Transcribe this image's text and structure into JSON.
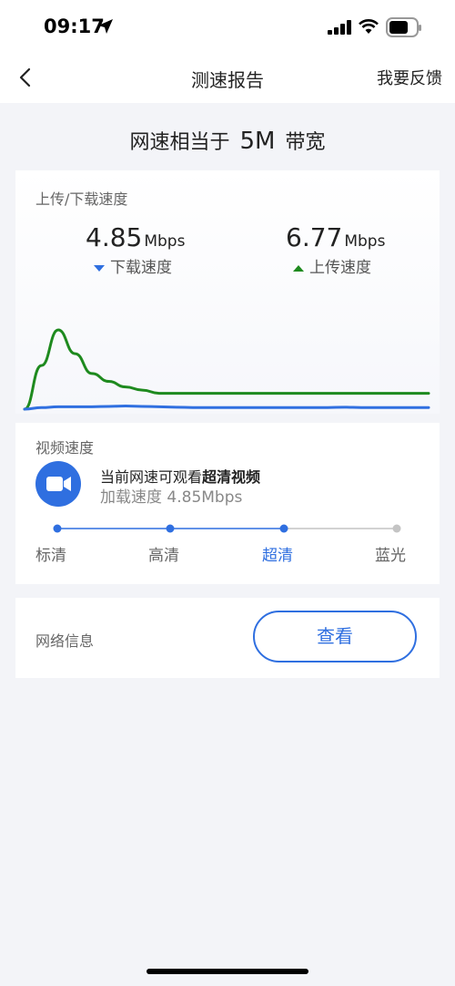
{
  "status": {
    "time": "09:17"
  },
  "nav": {
    "title": "测速报告",
    "feedback": "我要反馈"
  },
  "headline": {
    "prefix": "网速相当于",
    "value": "5M",
    "suffix": "带宽"
  },
  "speed_card": {
    "label": "上传/下载速度",
    "download": {
      "value": "4.85",
      "unit": "Mbps",
      "label": "下载速度"
    },
    "upload": {
      "value": "6.77",
      "unit": "Mbps",
      "label": "上传速度"
    }
  },
  "chart_data": {
    "type": "line",
    "series": [
      {
        "color": "#1e8a1e",
        "values": [
          0.0,
          0.55,
          1.0,
          0.7,
          0.45,
          0.35,
          0.28,
          0.24,
          0.2,
          0.2,
          0.2,
          0.2,
          0.2,
          0.2,
          0.2,
          0.2,
          0.2,
          0.2,
          0.2,
          0.2,
          0.2,
          0.2,
          0.2,
          0.2,
          0.2
        ]
      },
      {
        "color": "#2f6fe0",
        "values": [
          0.0,
          0.02,
          0.03,
          0.03,
          0.03,
          0.035,
          0.04,
          0.035,
          0.03,
          0.025,
          0.02,
          0.02,
          0.02,
          0.02,
          0.02,
          0.02,
          0.02,
          0.02,
          0.02,
          0.025,
          0.02,
          0.02,
          0.02,
          0.02,
          0.02
        ]
      }
    ]
  },
  "video_card": {
    "label": "视频速度",
    "line1_prefix": "当前网速可观看",
    "line1_bold": "超清视频",
    "line2": "加载速度 4.85Mbps",
    "icon": "video-camera-icon",
    "qualities": [
      "标清",
      "高清",
      "超清",
      "蓝光"
    ],
    "active_level": 3
  },
  "net_card": {
    "label": "网络信息",
    "button": "查看"
  },
  "colors": {
    "accent": "#2f6fe0",
    "upload": "#1e8a1e",
    "inactive": "#c4c4c4"
  }
}
